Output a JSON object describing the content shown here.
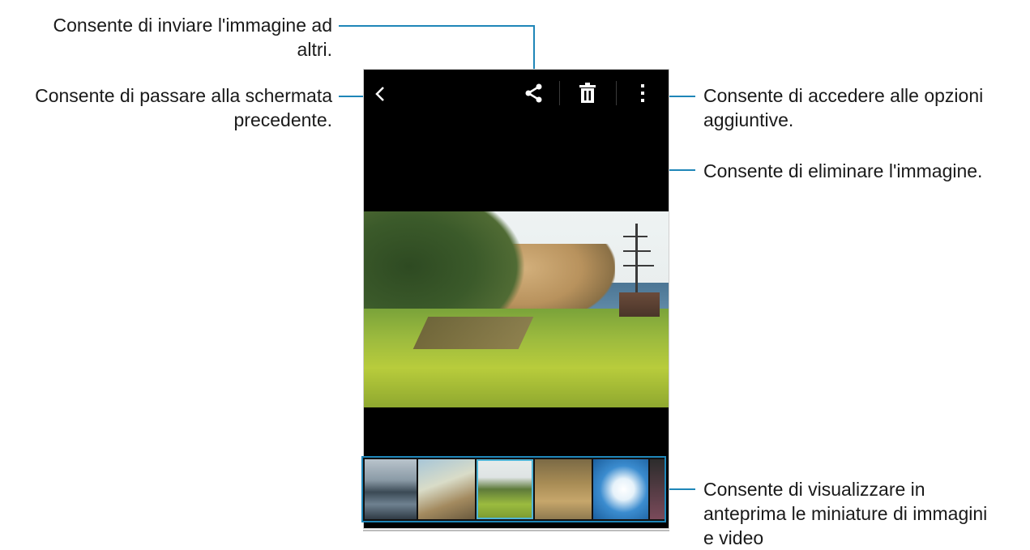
{
  "callouts": {
    "share": "Consente di inviare l'immagine ad altri.",
    "share_line1": "Consente di inviare l'immagine ad",
    "share_line2": "altri.",
    "back_line1": "Consente di passare alla schermata",
    "back_line2": "precedente.",
    "more_line1": "Consente di accedere alle opzioni",
    "more_line2": "aggiuntive.",
    "delete": "Consente di eliminare l'immagine.",
    "thumbs_line1": "Consente di visualizzare in",
    "thumbs_line2": "anteprima le miniature di immagini",
    "thumbs_line3": "e video"
  },
  "actionbar": {
    "icons": [
      "back-icon",
      "share-icon",
      "delete-icon",
      "more-options-icon"
    ]
  },
  "filmstrip": {
    "thumbnail_count": 6,
    "selected_index": 2
  },
  "colors": {
    "accent": "#1f86b8",
    "phone_background": "#000000"
  }
}
